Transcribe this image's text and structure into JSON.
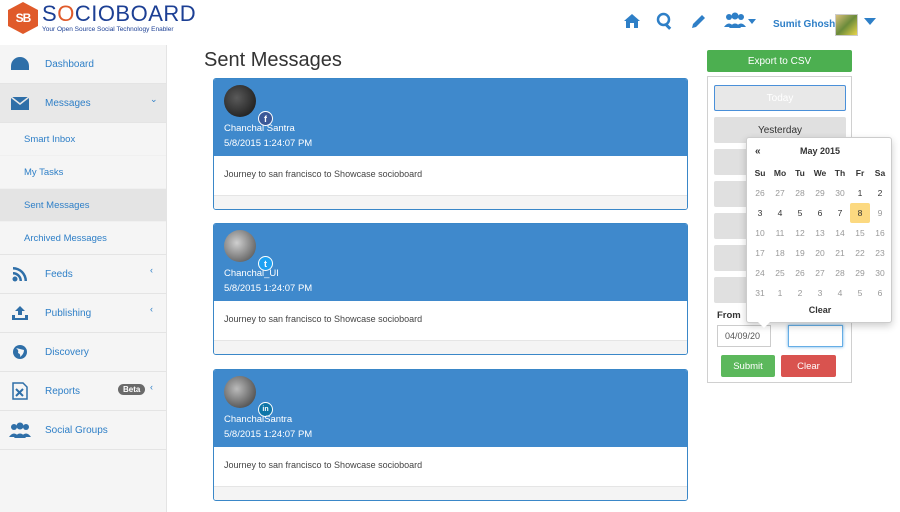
{
  "header": {
    "logo_mark": "SB",
    "logo_word_a": "S",
    "logo_word_o": "O",
    "logo_word_b": "CIOBOARD",
    "tagline": "Your Open Source Social Technology Enabler",
    "user_name": "Sumit Ghosh",
    "icons": [
      "home-icon",
      "search-icon",
      "pencil-icon",
      "users-icon"
    ],
    "accent_color": "#2e7fc7"
  },
  "sidebar": {
    "items": [
      {
        "label": "Dashboard",
        "icon": "dashboard-icon"
      },
      {
        "label": "Messages",
        "icon": "envelope-icon",
        "chevron": "⌄"
      },
      {
        "label": "Feeds",
        "icon": "rss-icon",
        "chevron": "‹"
      },
      {
        "label": "Publishing",
        "icon": "upload-icon",
        "chevron": "‹"
      },
      {
        "label": "Discovery",
        "icon": "globe-icon"
      },
      {
        "label": "Reports",
        "icon": "excel-icon",
        "chevron": "‹",
        "badge": "Beta"
      },
      {
        "label": "Social Groups",
        "icon": "group-icon"
      }
    ],
    "sub_items": [
      "Smart Inbox",
      "My Tasks",
      "Sent Messages",
      "Archived Messages"
    ]
  },
  "main": {
    "title": "Sent Messages",
    "messages": [
      {
        "name": "Chanchal Santra",
        "date": "5/8/2015 1:24:07 PM",
        "text": "Journey to san francisco to Showcase socioboard",
        "network": "f"
      },
      {
        "name": "Chanchal_UI",
        "date": "5/8/2015 1:24:07 PM",
        "text": "Journey to san francisco to Showcase socioboard",
        "network": "t"
      },
      {
        "name": "ChanchalSantra",
        "date": "5/8/2015 1:24:07 PM",
        "text": "Journey to san francisco to Showcase socioboard",
        "network": "in"
      }
    ]
  },
  "filters": {
    "export_label": "Export to CSV",
    "today": "Today",
    "yesterday": "Yesterday",
    "from_label": "From",
    "from_value": "04/09/20",
    "to_value": "",
    "submit": "Submit",
    "clear": "Clear"
  },
  "calendar": {
    "prev": "«",
    "month": "May 2015",
    "weekdays": [
      "Su",
      "Mo",
      "Tu",
      "We",
      "Th",
      "Fr",
      "Sa"
    ],
    "weeks": [
      [
        "26",
        "27",
        "28",
        "29",
        "30",
        "1",
        "2"
      ],
      [
        "3",
        "4",
        "5",
        "6",
        "7",
        "8",
        "9"
      ],
      [
        "10",
        "11",
        "12",
        "13",
        "14",
        "15",
        "16"
      ],
      [
        "17",
        "18",
        "19",
        "20",
        "21",
        "22",
        "23"
      ],
      [
        "24",
        "25",
        "26",
        "27",
        "28",
        "29",
        "30"
      ],
      [
        "31",
        "1",
        "2",
        "3",
        "4",
        "5",
        "6"
      ]
    ],
    "selected_day": "8",
    "clear": "Clear"
  }
}
